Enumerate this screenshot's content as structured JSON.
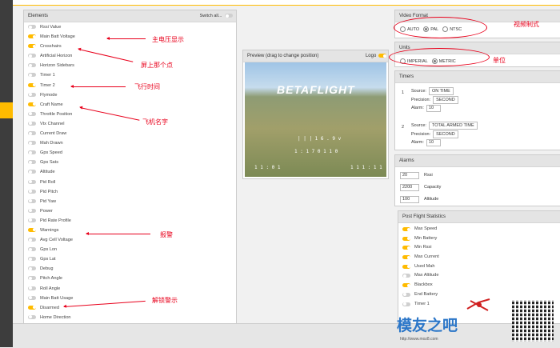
{
  "elements_panel": {
    "title": "Elements",
    "switch_all_label": "Switch all...",
    "items": [
      {
        "label": "Rssi Value",
        "on": false
      },
      {
        "label": "Main Batt Voltage",
        "on": true
      },
      {
        "label": "Crosshairs",
        "on": true
      },
      {
        "label": "Artificial Horizon",
        "on": false
      },
      {
        "label": "Horizon Sidebars",
        "on": false
      },
      {
        "label": "Timer 1",
        "on": false
      },
      {
        "label": "Timer 2",
        "on": true
      },
      {
        "label": "Flymode",
        "on": false
      },
      {
        "label": "Craft Name",
        "on": true
      },
      {
        "label": "Throttle Position",
        "on": false
      },
      {
        "label": "Vtx Channel",
        "on": false
      },
      {
        "label": "Current Draw",
        "on": false
      },
      {
        "label": "Mah Drawn",
        "on": false
      },
      {
        "label": "Gps Speed",
        "on": false
      },
      {
        "label": "Gps Sats",
        "on": false
      },
      {
        "label": "Altitude",
        "on": false
      },
      {
        "label": "Pid Roll",
        "on": false
      },
      {
        "label": "Pid Pitch",
        "on": false
      },
      {
        "label": "Pid Yaw",
        "on": false
      },
      {
        "label": "Power",
        "on": false
      },
      {
        "label": "Pid Rate Profile",
        "on": false
      },
      {
        "label": "Warnings",
        "on": true
      },
      {
        "label": "Avg Cell Voltage",
        "on": false
      },
      {
        "label": "Gps Lon",
        "on": false
      },
      {
        "label": "Gps Lat",
        "on": false
      },
      {
        "label": "Debug",
        "on": false
      },
      {
        "label": "Pitch Angle",
        "on": false
      },
      {
        "label": "Roll Angle",
        "on": false
      },
      {
        "label": "Main Batt Usage",
        "on": false
      },
      {
        "label": "Disarmed",
        "on": true
      },
      {
        "label": "Home Direction",
        "on": false
      }
    ]
  },
  "preview": {
    "title": "Preview (drag to change position)",
    "logo_label": "Logo",
    "osd_logo": "BETAFLIGHT",
    "osd_line1": "| | | 1 6 . 9 v",
    "osd_line2": "1 : 1 7 0 1 1 0",
    "osd_bl": "1 1 : 0 1",
    "osd_br": "1 1 1 : 1 1"
  },
  "video_format": {
    "title": "Video Format",
    "options": [
      "AUTO",
      "PAL",
      "NTSC"
    ],
    "selected": "PAL"
  },
  "units": {
    "title": "Units",
    "options": [
      "IMPERIAL",
      "METRIC"
    ],
    "selected": "METRIC"
  },
  "timers": {
    "title": "Timers",
    "source_label": "Source:",
    "precision_label": "Precision:",
    "alarm_label": "Alarm:",
    "list": [
      {
        "num": "1",
        "source": "ON TIME",
        "precision": "SECOND",
        "alarm": "10"
      },
      {
        "num": "2",
        "source": "TOTAL ARMED TIME",
        "precision": "SECOND",
        "alarm": "10"
      }
    ]
  },
  "alarms": {
    "title": "Alarms",
    "items": [
      {
        "value": "20",
        "label": "Rssi"
      },
      {
        "value": "2200",
        "label": "Capacity"
      },
      {
        "value": "100",
        "label": "Altitude"
      }
    ]
  },
  "post_flight": {
    "title": "Post Flight Statistics",
    "items": [
      {
        "label": "Max Speed",
        "on": true
      },
      {
        "label": "Min Battery",
        "on": true
      },
      {
        "label": "Min Rssi",
        "on": true
      },
      {
        "label": "Max Current",
        "on": true
      },
      {
        "label": "Used Mah",
        "on": true
      },
      {
        "label": "Max Altitude",
        "on": false
      },
      {
        "label": "Blackbox",
        "on": true
      },
      {
        "label": "End Battery",
        "on": false
      },
      {
        "label": "Timer 1",
        "on": false
      }
    ]
  },
  "annotations": {
    "main_voltage": "主电压显示",
    "crosshair": "屏上那个点",
    "flight_time": "飞行时间",
    "craft_name": "飞机名字",
    "warnings": "报警",
    "disarm_warning": "解锁警示",
    "video_format": "视频制式",
    "units": "单位"
  },
  "watermark": {
    "text": "模友之吧",
    "url": "http://www.moz8.com"
  },
  "colors": {
    "accent": "#ffbb00",
    "annotation": "#e8001b"
  }
}
